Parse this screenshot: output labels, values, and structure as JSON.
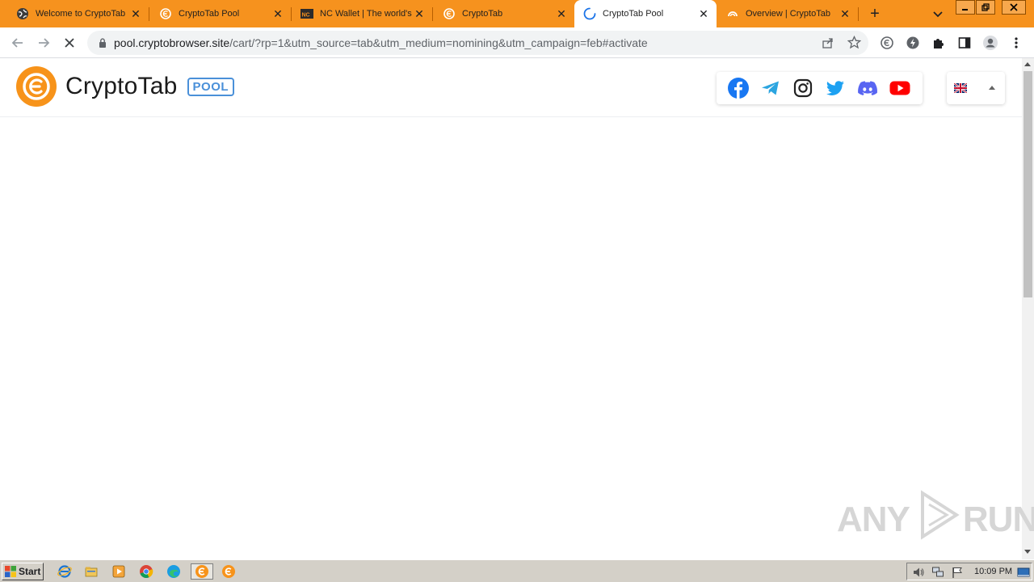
{
  "browser": {
    "tabs": [
      {
        "title": "Welcome to CryptoTab",
        "icon": "globe-icon",
        "active": false
      },
      {
        "title": "CryptoTab Pool",
        "icon": "cryptotab-icon",
        "active": false
      },
      {
        "title": "NC Wallet | The world's",
        "icon": "ncwallet-icon",
        "active": false
      },
      {
        "title": "CryptoTab",
        "icon": "cryptotab-icon",
        "active": false
      },
      {
        "title": "CryptoTab Pool",
        "icon": "loading-spinner-icon",
        "active": true
      },
      {
        "title": "Overview | CryptoTab",
        "icon": "cryptotab-overview-icon",
        "active": false
      }
    ],
    "url_host": "pool.cryptobrowser.site",
    "url_path": "/cart/?rp=1&utm_source=tab&utm_medium=nomining&utm_campaign=feb#activate"
  },
  "site": {
    "logo_text": "CryptoTab",
    "logo_badge": "POOL",
    "socials": [
      "facebook-icon",
      "telegram-icon",
      "instagram-icon",
      "twitter-icon",
      "discord-icon",
      "youtube-icon"
    ],
    "language": "uk-flag-icon"
  },
  "watermark": {
    "text_left": "ANY",
    "text_right": "RUN"
  },
  "taskbar": {
    "start_label": "Start",
    "clock": "10:09 PM"
  },
  "colors": {
    "tabstrip": "#f6921e",
    "brand_orange": "#f7931a",
    "pool_blue": "#4a90d9"
  }
}
